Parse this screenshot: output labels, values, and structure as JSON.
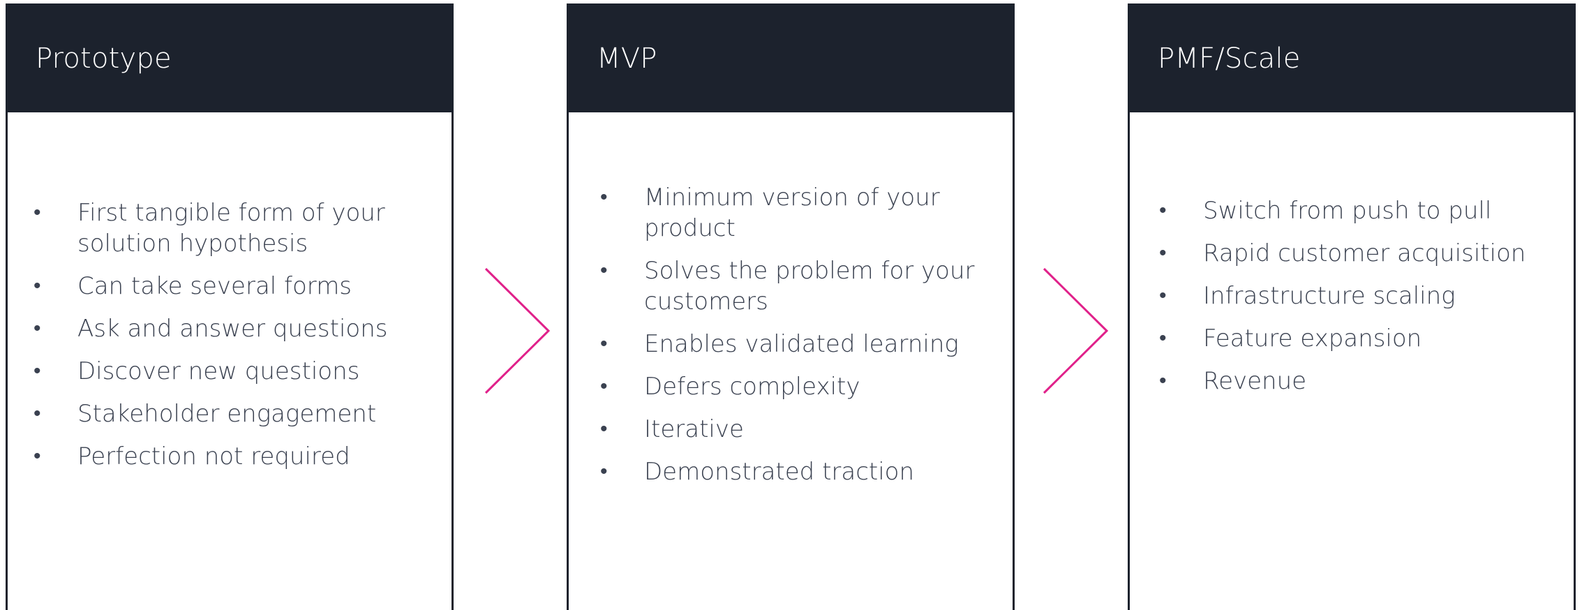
{
  "accent_color": "#e0218a",
  "header_color": "#1c222d",
  "stages": [
    {
      "title": "Prototype",
      "items": [
        "First tangible form of your solution hypothesis",
        "Can take several forms",
        "Ask and answer questions",
        "Discover new questions",
        "Stakeholder engagement",
        "Perfection not required"
      ]
    },
    {
      "title": "MVP",
      "items": [
        "Minimum version of your product",
        "Solves the problem for your customers",
        "Enables validated learning",
        "Defers complexity",
        "Iterative",
        "Demonstrated traction"
      ]
    },
    {
      "title": "PMF/Scale",
      "items": [
        "Switch from push to pull",
        "Rapid customer acquisition",
        "Infrastructure scaling",
        "Feature expansion",
        "Revenue"
      ]
    }
  ]
}
